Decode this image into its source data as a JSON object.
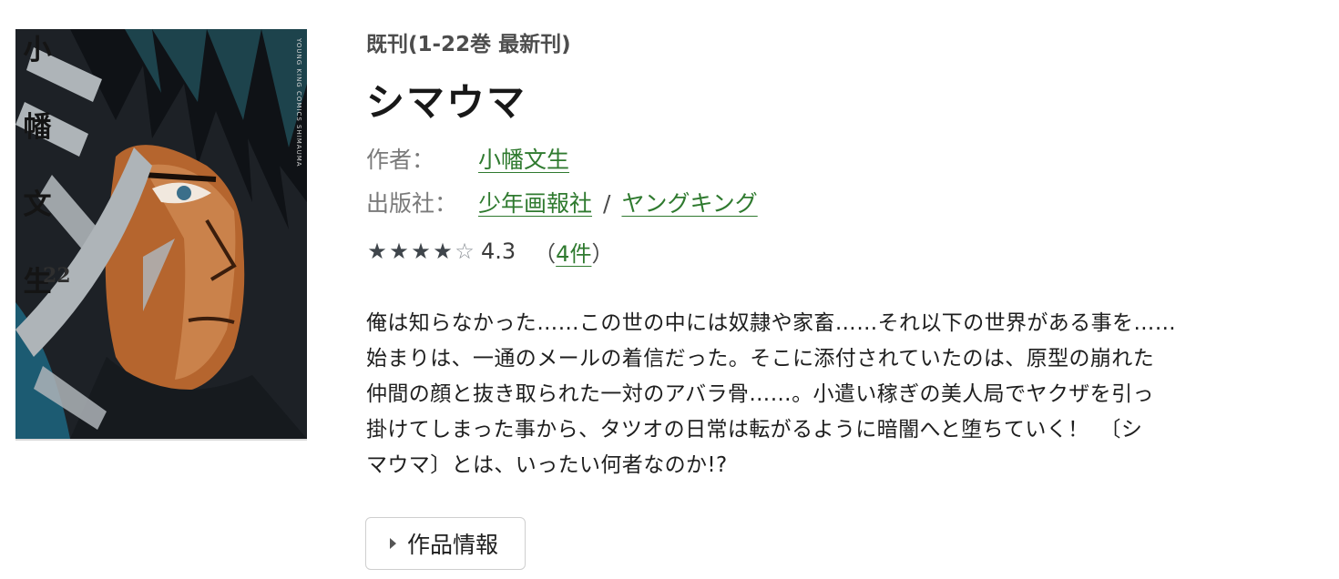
{
  "cover": {
    "author_chars": [
      "小",
      "幡",
      "文",
      "生"
    ],
    "volume": "22",
    "spine_text": "YOUNG KING COMICS  SHIMAUMA"
  },
  "book": {
    "series_status": "既刊(1-22巻 最新刊)",
    "title": "シマウマ",
    "author_label": "作者：",
    "author": "小幡文生",
    "publisher_label": "出版社：",
    "publisher": "少年画報社",
    "separator": "/",
    "label": "ヤングキング"
  },
  "rating": {
    "stars_filled": 4,
    "stars_total": 5,
    "value": "4.3",
    "count_open": "（",
    "count_link": "4件",
    "count_close": "）"
  },
  "synopsis": [
    "俺は知らなかった……この世の中には奴隷や家畜……それ以下の世界がある事を……",
    "始まりは、一通のメールの着信だった。そこに添付されていたのは、原型の崩れた",
    "仲間の顔と抜き取られた一対のアバラ骨……。小遣い稼ぎの美人局でヤクザを引っ",
    "掛けてしまった事から、タツオの日常は転がるように暗闇へと堕ちていく！　〔シ",
    "マウマ〕とは、いったい何者なのか!?"
  ],
  "button": {
    "label": "作品情報",
    "icon": "caret-right-icon"
  },
  "colors": {
    "link": "#2f7a2f",
    "star": "#3f454b",
    "button_border": "#cfcfcf"
  }
}
